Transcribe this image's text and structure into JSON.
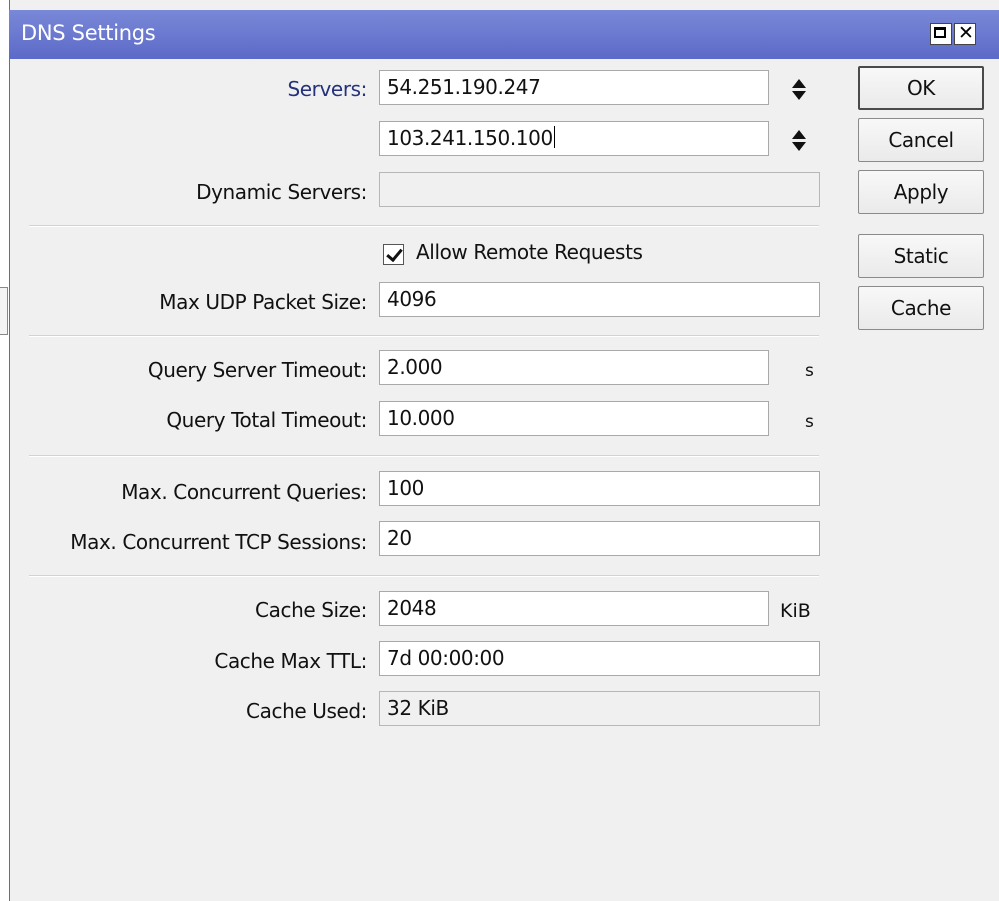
{
  "window": {
    "title": "DNS Settings"
  },
  "fields": {
    "servers_label": "Servers:",
    "server1": "54.251.190.247",
    "server2": "103.241.150.100",
    "dynamic_servers_label": "Dynamic Servers:",
    "dynamic_servers": "",
    "allow_remote_label": "Allow Remote Requests",
    "allow_remote_checked": true,
    "max_udp_label": "Max UDP Packet Size:",
    "max_udp": "4096",
    "query_server_timeout_label": "Query Server Timeout:",
    "query_server_timeout": "2.000",
    "query_server_timeout_unit": "s",
    "query_total_timeout_label": "Query Total Timeout:",
    "query_total_timeout": "10.000",
    "query_total_timeout_unit": "s",
    "max_concurrent_queries_label": "Max. Concurrent Queries:",
    "max_concurrent_queries": "100",
    "max_concurrent_tcp_label": "Max. Concurrent TCP Sessions:",
    "max_concurrent_tcp": "20",
    "cache_size_label": "Cache Size:",
    "cache_size": "2048",
    "cache_size_unit": "KiB",
    "cache_max_ttl_label": "Cache Max TTL:",
    "cache_max_ttl": "7d 00:00:00",
    "cache_used_label": "Cache Used:",
    "cache_used": "32 KiB"
  },
  "buttons": {
    "ok": "OK",
    "cancel": "Cancel",
    "apply": "Apply",
    "static": "Static",
    "cache": "Cache"
  },
  "colors": {
    "titlebar": "#5c6ac8",
    "window_bg": "#f0f0f0",
    "servers_label": "#25317a"
  },
  "icons": {
    "maximize": "maximize-icon",
    "close": "close-icon",
    "spinner": "up-down-arrows-icon",
    "check": "checkmark-icon"
  }
}
